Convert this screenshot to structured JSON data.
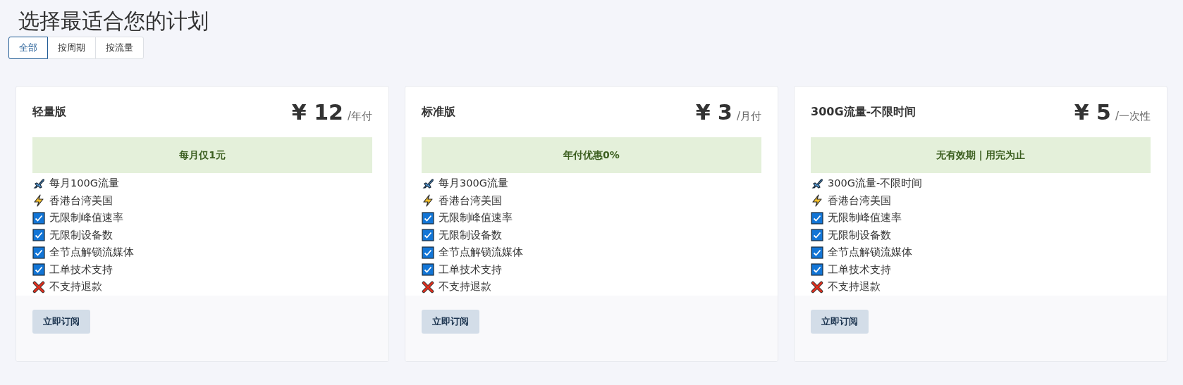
{
  "title": "选择最适合您的计划",
  "tabs": [
    {
      "label": "全部",
      "selected": true
    },
    {
      "label": "按周期",
      "selected": false
    },
    {
      "label": "按流量",
      "selected": false
    }
  ],
  "plans": [
    {
      "name": "轻量版",
      "currency": "¥",
      "price": "12",
      "period": "/年付",
      "banner": "每月仅1元",
      "features": [
        {
          "kind": "plane",
          "text": "每月100G流量"
        },
        {
          "kind": "bolt",
          "text": "香港台湾美国"
        },
        {
          "kind": "check",
          "text": "无限制峰值速率"
        },
        {
          "kind": "check",
          "text": "无限制设备数"
        },
        {
          "kind": "check",
          "text": "全节点解锁流媒体"
        },
        {
          "kind": "check",
          "text": "工单技术支持"
        },
        {
          "kind": "cross",
          "text": "不支持退款"
        }
      ],
      "button": "立即订阅"
    },
    {
      "name": "标准版",
      "currency": "¥",
      "price": "3",
      "period": "/月付",
      "banner": "年付优惠0%",
      "features": [
        {
          "kind": "plane",
          "text": "每月300G流量"
        },
        {
          "kind": "bolt",
          "text": "香港台湾美国"
        },
        {
          "kind": "check",
          "text": "无限制峰值速率"
        },
        {
          "kind": "check",
          "text": "无限制设备数"
        },
        {
          "kind": "check",
          "text": "全节点解锁流媒体"
        },
        {
          "kind": "check",
          "text": "工单技术支持"
        },
        {
          "kind": "cross",
          "text": "不支持退款"
        }
      ],
      "button": "立即订阅"
    },
    {
      "name": "300G流量-不限时间",
      "currency": "¥",
      "price": "5",
      "period": "/一次性",
      "banner": "无有效期 | 用完为止",
      "features": [
        {
          "kind": "plane",
          "text": "300G流量-不限时间"
        },
        {
          "kind": "bolt",
          "text": "香港台湾美国"
        },
        {
          "kind": "check",
          "text": "无限制峰值速率"
        },
        {
          "kind": "check",
          "text": "无限制设备数"
        },
        {
          "kind": "check",
          "text": "全节点解锁流媒体"
        },
        {
          "kind": "check",
          "text": "工单技术支持"
        },
        {
          "kind": "cross",
          "text": "不支持退款"
        }
      ],
      "button": "立即订阅"
    }
  ]
}
